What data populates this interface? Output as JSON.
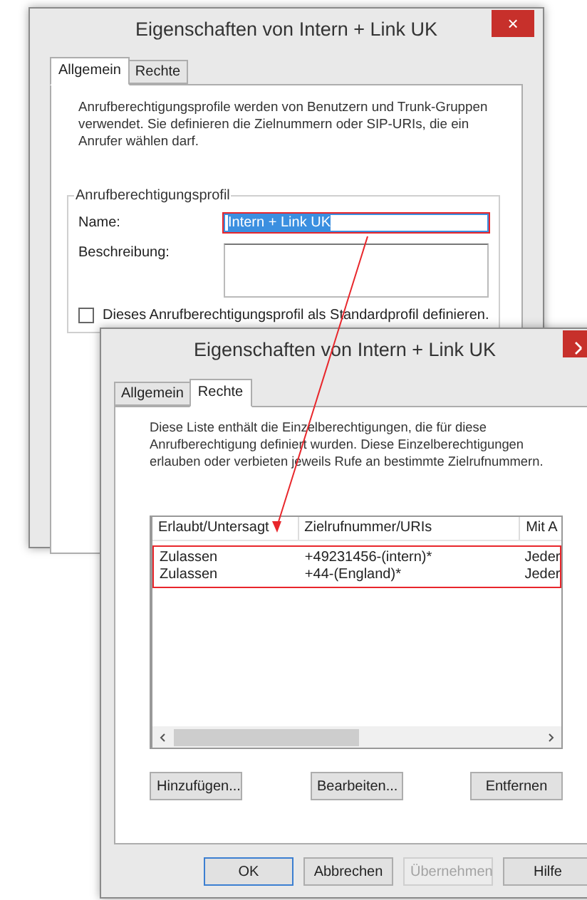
{
  "windows": [
    {
      "title": "Eigenschaften von Intern + Link UK",
      "close": "×",
      "tabs": [
        {
          "label": "Allgemein",
          "selected": true
        },
        {
          "label": "Rechte",
          "selected": false
        }
      ],
      "description": "Anrufberechtigungsprofile werden von Benutzern und Trunk-Gruppen verwendet. Sie definieren die Zielnummern oder SIP-URIs, die ein Anrufer wählen darf.",
      "group": {
        "legend": "Anrufberechtigungsprofil",
        "fields": [
          {
            "kind": "line",
            "label": "Name:",
            "value": "Intern + Link UK",
            "highlighted": true,
            "marked": true
          },
          {
            "kind": "area",
            "label": "Beschreibung:",
            "marked": false
          }
        ],
        "checkbox": {
          "label": "Dieses Anrufberechtigungsprofil als Standardprofil definieren.",
          "checked": false
        }
      }
    },
    {
      "title": "Eigenschaften von Intern + Link UK",
      "tabs": [
        {
          "label": "Allgemein",
          "selected": false
        },
        {
          "label": "Rechte",
          "selected": true
        }
      ],
      "description": "Diese Liste enthält die Einzelberechtigungen, die für diese Anrufberechtigung definiert wurden. Diese Einzelberechtigungen erlauben oder verbieten jeweils Rufe an bestimmte Zielrufnummern.",
      "table": {
        "columns": [
          "Erlaubt/Untersagt",
          "Zielrufnummer/URIs",
          "Mit A"
        ],
        "rows": [
          [
            "Zulassen",
            "+49231456-(intern)*",
            "Jeder"
          ],
          [
            "Zulassen",
            "+44-(England)*",
            "Jeder"
          ]
        ],
        "marked": true
      },
      "actions": [
        "Hinzufügen...",
        "Bearbeiten...",
        "Entfernen"
      ],
      "buttons": [
        {
          "label": "OK",
          "default": true,
          "disabled": false
        },
        {
          "label": "Abbrechen",
          "default": false,
          "disabled": false
        },
        {
          "label": "Übernehmen",
          "default": false,
          "disabled": true
        },
        {
          "label": "Hilfe",
          "default": false,
          "disabled": false
        }
      ]
    }
  ]
}
